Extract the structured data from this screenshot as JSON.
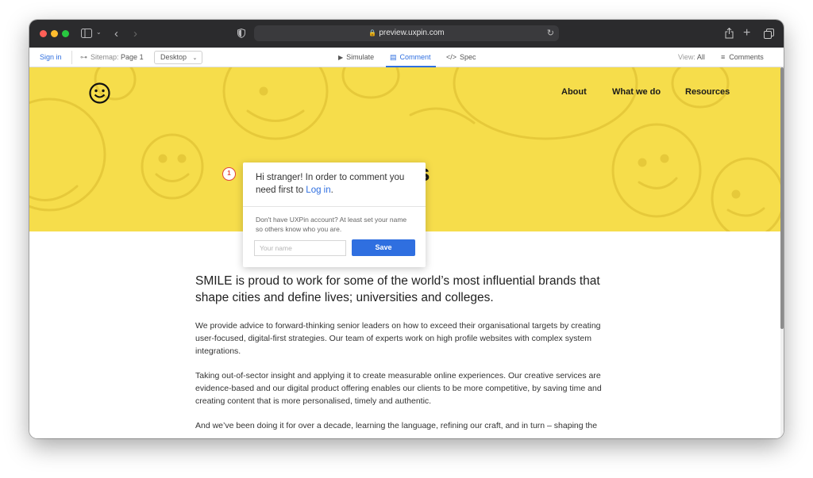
{
  "browser": {
    "url": "preview.uxpin.com",
    "traffic_lights": [
      "#ff5f57",
      "#febc2e",
      "#28c840"
    ]
  },
  "uxbar": {
    "sign_in": "Sign in",
    "sitemap_label": "Sitemap:",
    "sitemap_page": "Page 1",
    "device": "Desktop",
    "simulate": "Simulate",
    "comment": "Comment",
    "spec": "Spec",
    "view_label": "View:",
    "view_value": "All",
    "comments": "Comments"
  },
  "site": {
    "nav": [
      "About",
      "What we do",
      "Resources"
    ],
    "hero_title": "us",
    "hero_color": "#f6dd4b",
    "lead": "SMILE is proud to work for some of the world’s most influential brands that shape cities and define lives; universities and colleges.",
    "paragraphs": [
      "We provide advice to forward-thinking senior leaders on how to exceed their organisational targets by creating user-focused, digital-first strategies. Our team of experts work on high profile websites with complex system integrations.",
      "Taking out-of-sector insight and applying it to create measurable online experiences. Our creative services are evidence-based and our digital product offering enables our clients to be more competitive, by saving time and creating content that is more personalised, timely and authentic.",
      "And we’ve been doing it for over a decade, learning the language, refining our craft, and in turn – shaping the"
    ]
  },
  "comment_popup": {
    "marker_number": "1",
    "greeting": "Hi stranger! In order to comment you need first to",
    "login_link": "Log in",
    "greeting_end": ".",
    "note": "Don't have UXPin account? At least set your name so others know who you are.",
    "name_placeholder": "Your name",
    "save_label": "Save"
  }
}
